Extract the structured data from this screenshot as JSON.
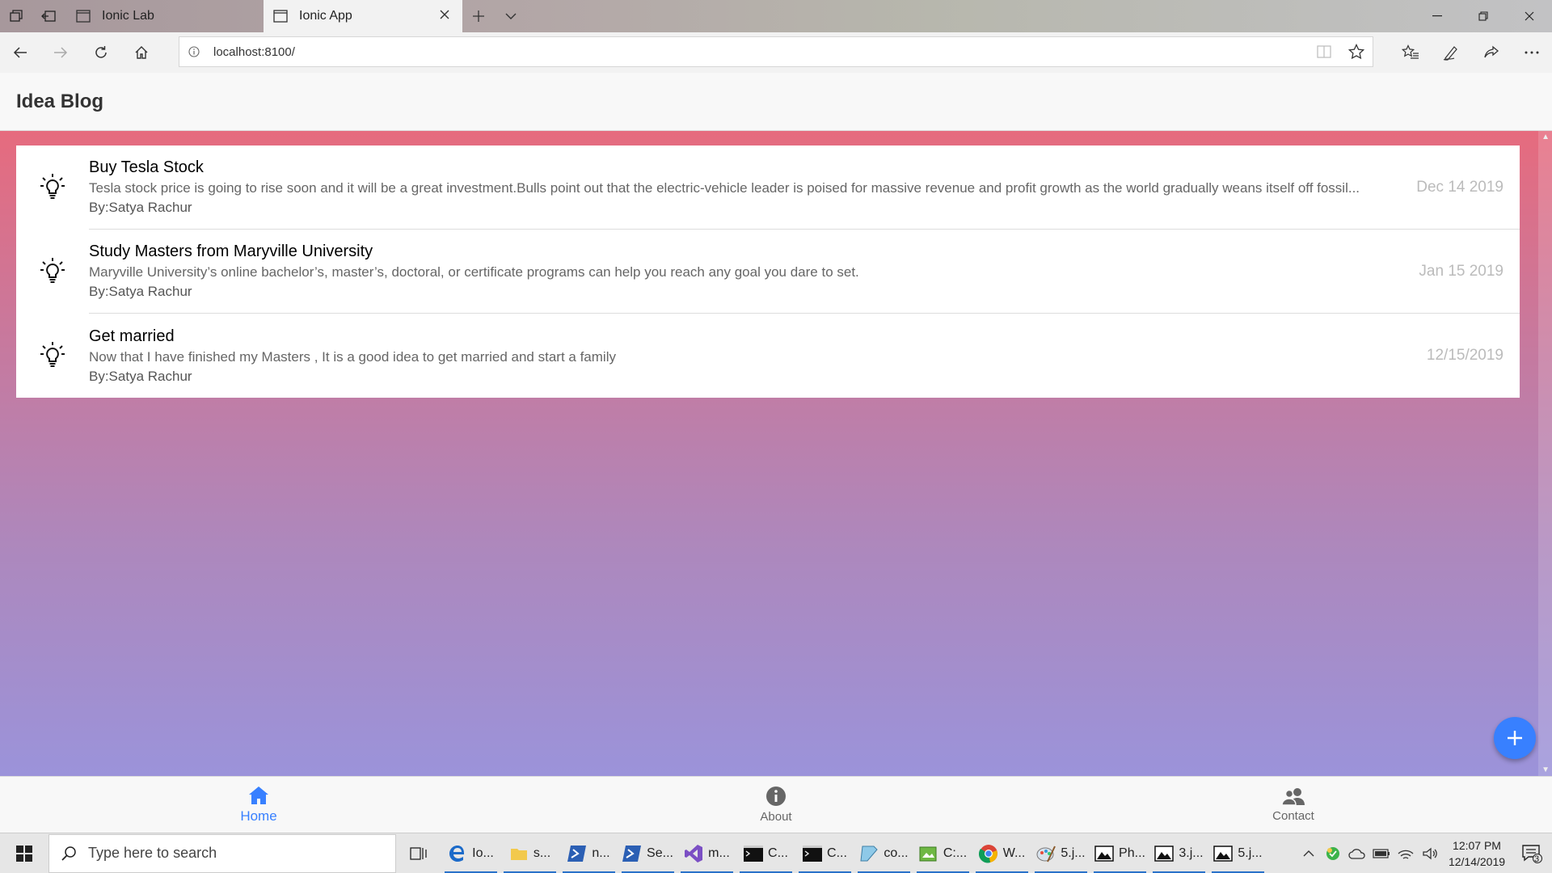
{
  "browser": {
    "tabs": [
      {
        "title": "Ionic Lab",
        "active": false
      },
      {
        "title": "Ionic App",
        "active": true
      }
    ],
    "url": "localhost:8100/"
  },
  "app": {
    "title": "Idea Blog",
    "ideas": [
      {
        "title": "Buy Tesla Stock",
        "description": "Tesla stock price is going to rise soon and it will be a great investment.Bulls point out that the electric-vehicle leader is poised for massive revenue and profit growth as the world gradually weans itself off fossil...",
        "author": "By:Satya Rachur",
        "date": "Dec 14 2019"
      },
      {
        "title": "Study Masters from Maryville University",
        "description": "Maryville University’s online bachelor’s, master’s, doctoral, or certificate programs can help you reach any goal you dare to set.",
        "author": "By:Satya Rachur",
        "date": "Jan 15 2019"
      },
      {
        "title": "Get married",
        "description": "Now that I have finished my Masters , It is a good idea to get married and start a family",
        "author": "By:Satya Rachur",
        "date": "12/15/2019"
      }
    ],
    "tabs": [
      {
        "label": "Home",
        "icon": "home-icon",
        "selected": true
      },
      {
        "label": "About",
        "icon": "info-icon",
        "selected": false
      },
      {
        "label": "Contact",
        "icon": "contacts-icon",
        "selected": false
      }
    ],
    "accent_color": "#3880ff"
  },
  "taskbar": {
    "search_placeholder": "Type here to search",
    "apps": [
      {
        "label": "Io...",
        "icon": "edge-icon"
      },
      {
        "label": "s...",
        "icon": "folder-icon"
      },
      {
        "label": "n...",
        "icon": "powershell-icon"
      },
      {
        "label": "Se...",
        "icon": "powershell-icon"
      },
      {
        "label": "m...",
        "icon": "visual-studio-icon"
      },
      {
        "label": "C...",
        "icon": "terminal-icon"
      },
      {
        "label": "C...",
        "icon": "terminal-icon"
      },
      {
        "label": "co...",
        "icon": "notepad-icon"
      },
      {
        "label": "C:...",
        "icon": "image-editor-icon"
      },
      {
        "label": "W...",
        "icon": "chrome-icon"
      },
      {
        "label": "5.j...",
        "icon": "paint-icon"
      },
      {
        "label": "Ph...",
        "icon": "photos-icon"
      },
      {
        "label": "3.j...",
        "icon": "photos-icon"
      },
      {
        "label": "5.j...",
        "icon": "photos-icon"
      }
    ],
    "time": "12:07 PM",
    "date": "12/14/2019",
    "notification_count": "3"
  }
}
